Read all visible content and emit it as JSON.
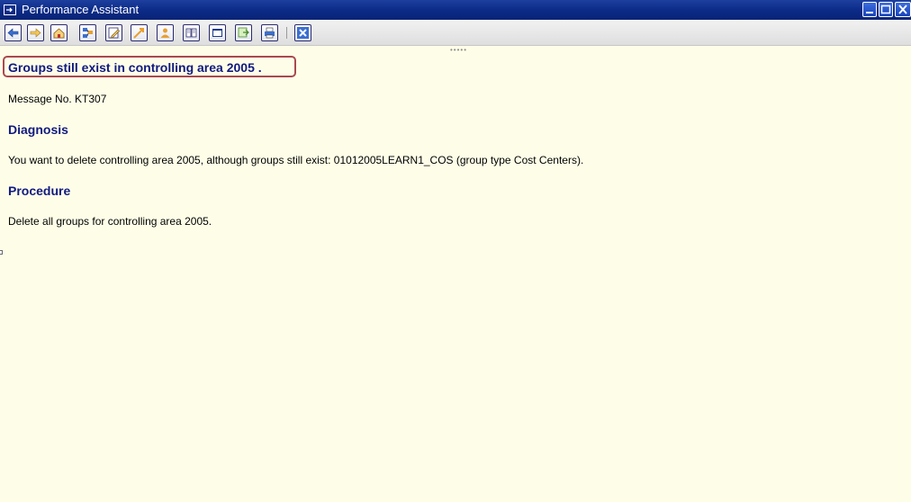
{
  "window": {
    "title": "Performance Assistant",
    "controls": [
      "minimize-icon",
      "maximize-icon",
      "close-icon"
    ]
  },
  "toolbar": {
    "buttons": [
      {
        "icon": "back-icon"
      },
      {
        "icon": "forward-icon"
      },
      {
        "icon": "home-icon"
      },
      {
        "icon": "structure-icon"
      },
      {
        "icon": "edit-icon"
      },
      {
        "icon": "expand-icon"
      },
      {
        "icon": "user-icon"
      },
      {
        "icon": "book-icon"
      },
      {
        "icon": "window-icon"
      },
      {
        "icon": "export-icon"
      },
      {
        "icon": "print-icon"
      },
      {
        "icon": "close-icon"
      }
    ]
  },
  "message": {
    "title": "Groups still exist in controlling area 2005 .",
    "number": "Message No. KT307",
    "diagnosis_heading": "Diagnosis",
    "diagnosis_text": "You want to delete controlling area 2005, although groups still exist: 01012005LEARN1_COS (group type Cost Centers).",
    "procedure_heading": "Procedure",
    "procedure_text": "Delete all groups for controlling area 2005."
  },
  "colors": {
    "titlebar": "#0b2a86",
    "heading": "#101a80",
    "highlight_border": "#a9494f",
    "background": "#fefee8"
  }
}
